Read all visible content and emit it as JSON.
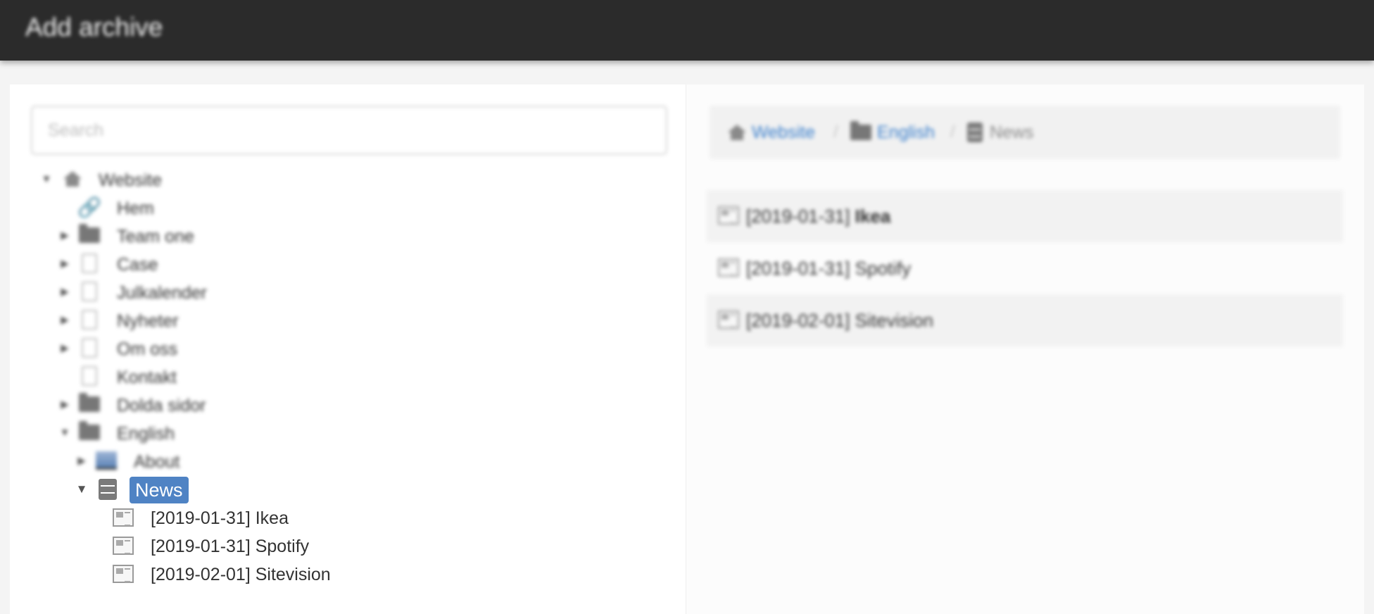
{
  "window": {
    "title": "Add archive"
  },
  "search": {
    "placeholder": "Search",
    "value": ""
  },
  "tree": {
    "root": {
      "label": "Website",
      "icon": "house-icon"
    },
    "items": [
      {
        "label": "Hem",
        "icon": "link-icon"
      },
      {
        "label": "Team one",
        "icon": "folder-icon"
      },
      {
        "label": "Case",
        "icon": "page-icon"
      },
      {
        "label": "Julkalender",
        "icon": "page-icon"
      },
      {
        "label": "Nyheter",
        "icon": "page-icon"
      },
      {
        "label": "Om oss",
        "icon": "page-icon"
      },
      {
        "label": "Kontakt",
        "icon": "page-icon"
      },
      {
        "label": "Dolda sidor",
        "icon": "folder-icon"
      },
      {
        "label": "English",
        "icon": "folder-icon"
      }
    ],
    "english_children": [
      {
        "label": "About",
        "icon": "image-page-icon"
      }
    ],
    "selected": {
      "label": "News",
      "icon": "archive-icon"
    },
    "archive_items": [
      {
        "label": "[2019-01-31] Ikea",
        "icon": "news-article-icon"
      },
      {
        "label": "[2019-01-31] Spotify",
        "icon": "news-article-icon"
      },
      {
        "label": "[2019-02-01] Sitevision",
        "icon": "news-article-icon"
      }
    ]
  },
  "breadcrumb": {
    "items": [
      {
        "label": "Website",
        "icon": "house-icon"
      },
      {
        "label": "English",
        "icon": "folder-icon"
      },
      {
        "label": "News",
        "icon": "archive-icon"
      }
    ],
    "separator": "/"
  },
  "archive_list": {
    "items": [
      {
        "label": "[2019-01-31] Ikea",
        "bold_part": "Ikea"
      },
      {
        "label": "[2019-01-31] Spotify"
      },
      {
        "label": "[2019-02-01] Sitevision"
      }
    ]
  },
  "colors": {
    "titlebar": "#2b2b2b",
    "selection": "#4f83c4",
    "link": "#3a7fcc"
  }
}
